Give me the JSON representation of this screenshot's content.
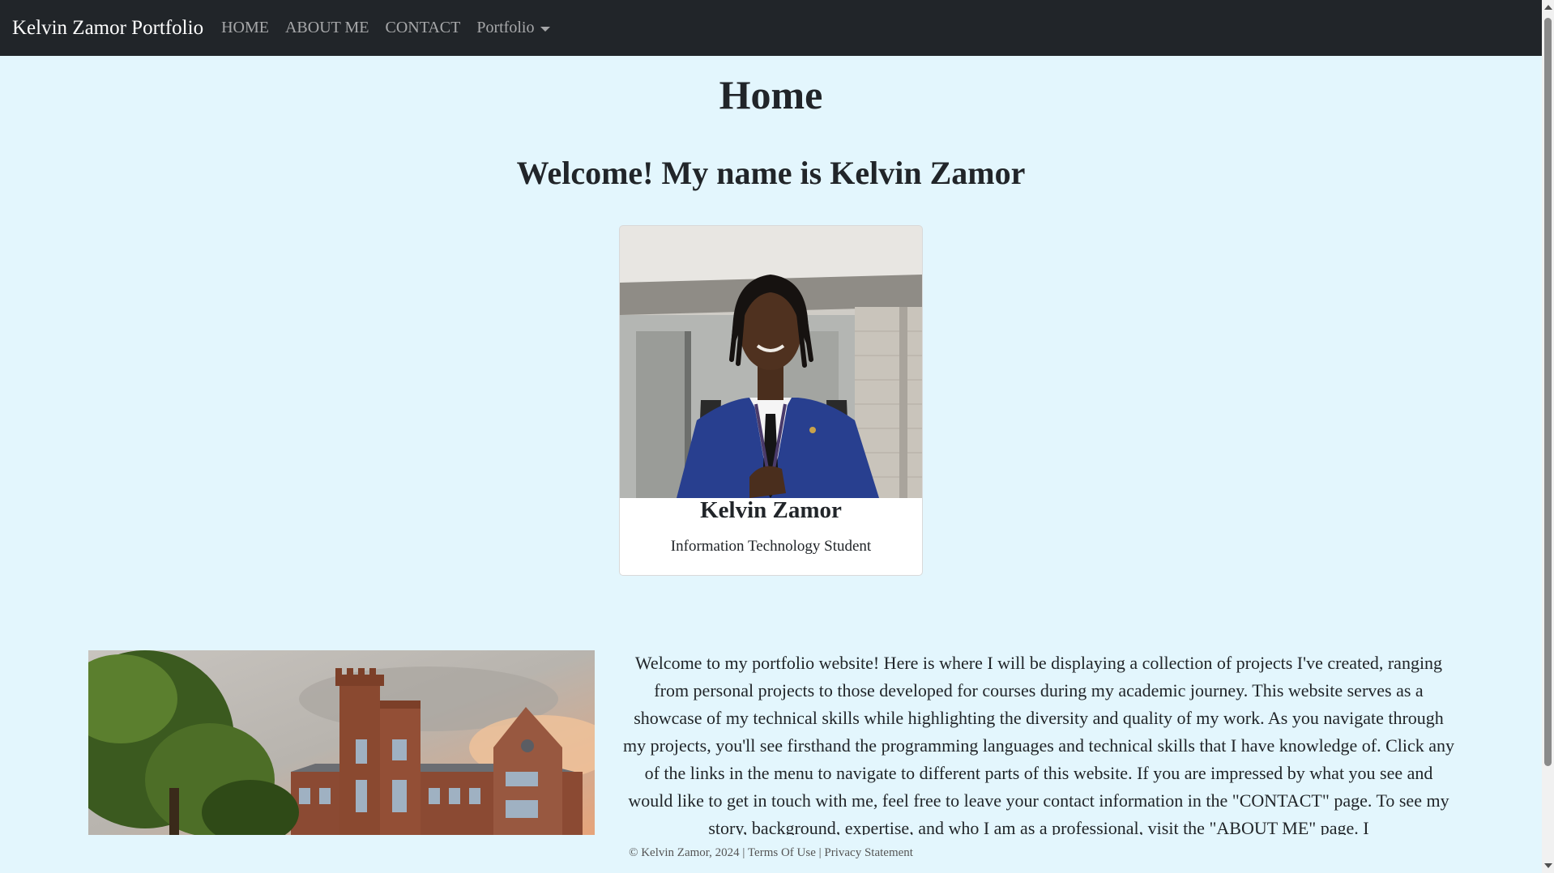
{
  "navbar": {
    "brand": "Kelvin Zamor Portfolio",
    "links": [
      "HOME",
      "ABOUT ME",
      "CONTACT"
    ],
    "dropdown_label": "Portfolio"
  },
  "main": {
    "title": "Home",
    "welcome": "Welcome! My name is Kelvin Zamor",
    "profile_card": {
      "name": "Kelvin Zamor",
      "role": "Information Technology Student",
      "photo": "portrait-photo"
    },
    "campus_image": "campus-building-photo",
    "intro_text": "Welcome to my portfolio website! Here is where I will be displaying a collection of projects I've created, ranging from personal projects to those developed for courses during my academic journey. This website serves as a showcase of my technical skills while highlighting the diversity and quality of my work. As you navigate through my projects, you'll see firsthand the programming languages and technical skills that I have knowledge of. Click any of the links in the menu to navigate to different parts of this website. If you are impressed by what you see and would like to get in touch with me, feel free to leave your contact information in the \"CONTACT\" page. To see my story, background, expertise, and who I am as a professional, visit the \"ABOUT ME\" page. I"
  },
  "footer": {
    "copyright": "© Kelvin Zamor, 2024",
    "separator": "|",
    "terms": "Terms Of Use",
    "privacy": "Privacy Statement"
  },
  "colors": {
    "navbar_bg": "#212529",
    "page_bg": "#e3f6fd"
  }
}
